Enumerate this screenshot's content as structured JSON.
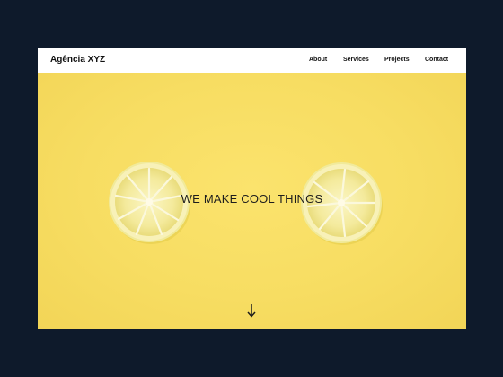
{
  "navbar": {
    "brand": "Agência XYZ",
    "links": [
      {
        "label": "About"
      },
      {
        "label": "Services"
      },
      {
        "label": "Projects"
      },
      {
        "label": "Contact"
      }
    ]
  },
  "hero": {
    "headline": "WE MAKE COOL THINGS",
    "scroll_icon": "arrow-down-icon",
    "background_color": "#f7dd62"
  },
  "colors": {
    "page_background": "#0e1a2b",
    "navbar_background": "#ffffff",
    "text": "#111111"
  }
}
